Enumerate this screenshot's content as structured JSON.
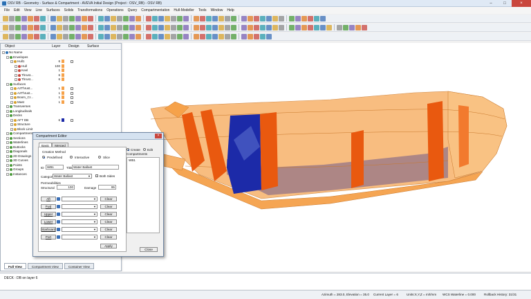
{
  "window": {
    "title": "OSV RB - Geometry - Surface & Compartment - AVEVA Initial Design (Project : OSV_RB) - OSV RB)"
  },
  "menu": [
    "File",
    "Edit",
    "View",
    "Line",
    "Surfaces",
    "Solids",
    "Transformations",
    "Operations",
    "Query",
    "Compartmentation",
    "Hull-Modeller",
    "Tools",
    "Window",
    "Help"
  ],
  "tree": {
    "headers": {
      "object": "Object",
      "layer": "Layer",
      "design": "Design",
      "surface": "Surface"
    },
    "items": [
      {
        "label": "No Name",
        "level": 0,
        "layer": "",
        "color": false,
        "check": false
      },
      {
        "label": "Envelopes",
        "level": 1,
        "layer": "",
        "color": false,
        "check": false
      },
      {
        "label": "Hull1",
        "level": 2,
        "layer": "6",
        "color": true,
        "check": true
      },
      {
        "label": "Hull",
        "level": 3,
        "layer": "100",
        "color": true,
        "check": false
      },
      {
        "label": "Keel",
        "level": 3,
        "layer": "1",
        "color": true,
        "check": false
      },
      {
        "label": "Thrust...",
        "level": 3,
        "layer": "6",
        "color": true,
        "check": false
      },
      {
        "label": "Thrust...",
        "level": 3,
        "layer": "6",
        "color": true,
        "check": false
      },
      {
        "label": "Surfaces",
        "level": 1,
        "layer": "",
        "color": false,
        "check": false
      },
      {
        "label": "AzThrust...",
        "level": 2,
        "layer": "1",
        "color": true,
        "check": true
      },
      {
        "label": "AzThrust...",
        "level": 2,
        "layer": "1",
        "color": true,
        "check": true
      },
      {
        "label": "Boom_Cr...",
        "level": 2,
        "layer": "1",
        "color": true,
        "check": true
      },
      {
        "label": "Mast",
        "level": 2,
        "layer": "1",
        "color": true,
        "check": true
      },
      {
        "label": "Transverses",
        "level": 1,
        "layer": "",
        "color": false,
        "check": false
      },
      {
        "label": "Longitudinals",
        "level": 1,
        "layer": "",
        "color": false,
        "check": false
      },
      {
        "label": "Decks",
        "level": 1,
        "layer": "",
        "color": false,
        "check": false
      },
      {
        "label": "AFT DB",
        "level": 2,
        "layer": "6",
        "color": true,
        "check": true
      },
      {
        "label": "Structure",
        "level": 2,
        "layer": "",
        "color": false,
        "check": false
      },
      {
        "label": "Block Limit",
        "level": 2,
        "layer": "",
        "color": false,
        "check": false
      },
      {
        "label": "Compartments",
        "level": 1,
        "layer": "",
        "color": false,
        "check": false
      },
      {
        "label": "Sections",
        "level": 1,
        "layer": "",
        "color": false,
        "check": false
      },
      {
        "label": "Waterlines",
        "level": 1,
        "layer": "",
        "color": false,
        "check": false
      },
      {
        "label": "Buttocks",
        "level": 1,
        "layer": "",
        "color": false,
        "check": false
      },
      {
        "label": "Diagonals",
        "level": 1,
        "layer": "",
        "color": false,
        "check": false
      },
      {
        "label": "2D Drawings",
        "level": 1,
        "layer": "",
        "color": false,
        "check": false
      },
      {
        "label": "3D Curves",
        "level": 1,
        "layer": "",
        "color": false,
        "check": false
      },
      {
        "label": "Points",
        "level": 1,
        "layer": "",
        "color": false,
        "check": false
      },
      {
        "label": "Groups",
        "level": 1,
        "layer": "",
        "color": false,
        "check": false
      },
      {
        "label": "Instances",
        "level": 1,
        "layer": "",
        "color": false,
        "check": false
      }
    ]
  },
  "bottom_tabs": [
    "Full View",
    "Compartment View",
    "Container View"
  ],
  "dialog": {
    "title": "Compartment Editor",
    "tabs": [
      "Basic",
      "Merged"
    ],
    "creation_method_label": "Creation Method",
    "methods": [
      "Predefined",
      "Interactive",
      "Slice"
    ],
    "id_label": "ID",
    "id_value": "WB1",
    "title_label": "Title",
    "title_value": "Water Ballast",
    "category_label": "Category",
    "category_value": "Water Ballast",
    "both_sides_label": "Both Sides",
    "permeabilities_label": "Permeabilities",
    "structural_label": "Structural",
    "structural_value": "100",
    "damage_label": "Damage",
    "damage_value": "95",
    "limit_rows": [
      "Aft",
      "Fwd",
      "Upper",
      "Lower",
      "Starboard",
      "Port"
    ],
    "limit_placeholder": "",
    "clear_label": "Clear",
    "apply_label": "Apply",
    "create_label": "Create",
    "edit_label": "Edit",
    "compartments_label": "Compartments",
    "compartments_list": [
      "WB1"
    ],
    "close_label": "Close"
  },
  "command": {
    "text": "DECK : DB on layer 6"
  },
  "status": {
    "azimuth": "Azimuth = 283.0, Elevation = 35.0",
    "layer": "Current Layer = 6",
    "units": "Units:X,Y,Z = m/t/mm",
    "waterline": "WCS Waterline = 0.000",
    "rollback": "Rollback History: 31/31"
  },
  "colors": {
    "hull": "#f6a24a",
    "bulkhead": "#e9590f",
    "tank": "#1c2aa8",
    "deck": "#a07c86"
  }
}
